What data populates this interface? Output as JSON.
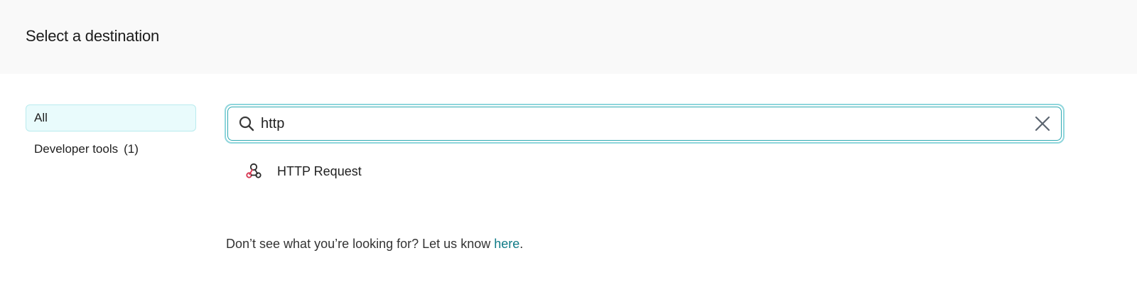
{
  "header": {
    "title": "Select a destination"
  },
  "sidebar": {
    "categories": [
      {
        "label": "All",
        "count": "",
        "active": true
      },
      {
        "label": "Developer tools",
        "count": "(1)",
        "active": false
      }
    ]
  },
  "search": {
    "value": "http",
    "icon": "search-icon",
    "clear_icon": "close-icon"
  },
  "results": [
    {
      "label": "HTTP Request",
      "icon": "webhook-icon"
    }
  ],
  "footer": {
    "text": "Don’t see what you’re looking for? Let us know ",
    "link_text": "here",
    "suffix": "."
  },
  "colors": {
    "accent": "#0e7a86",
    "active_bg": "#e9fbfc",
    "header_bg": "#f9f9f9",
    "webhook_red": "#d6334f"
  }
}
